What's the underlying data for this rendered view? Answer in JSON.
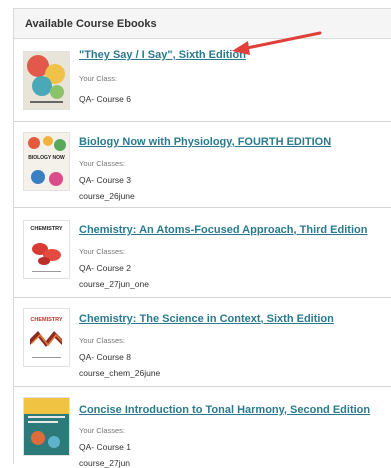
{
  "panel": {
    "title": "Available Course Ebooks"
  },
  "colors": {
    "link": "#2b7a8e",
    "arrow": "#e0403a"
  },
  "ebooks": [
    {
      "title": "\"They Say / I Say\", Sixth Edition",
      "classes_label": "Your Class:",
      "classes": [
        "QA- Course 6"
      ],
      "cover_icon": "they-say-cover"
    },
    {
      "title": "Biology Now with Physiology, FOURTH EDITION",
      "classes_label": "Your Classes:",
      "classes": [
        "QA- Course 3",
        "course_26june"
      ],
      "cover_icon": "biology-now-cover"
    },
    {
      "title": "Chemistry: An Atoms-Focused Approach, Third Edition",
      "classes_label": "Your Classes:",
      "classes": [
        "QA- Course 2",
        "course_27jun_one"
      ],
      "cover_icon": "chemistry-atoms-cover"
    },
    {
      "title": "Chemistry: The Science in Context, Sixth Edition",
      "classes_label": "Your Classes:",
      "classes": [
        "QA- Course 8",
        "course_chem_26june"
      ],
      "cover_icon": "chemistry-science-context-cover"
    },
    {
      "title": "Concise Introduction to Tonal Harmony, Second Edition",
      "classes_label": "Your Classes:",
      "classes": [
        "QA- Course 1",
        "course_27jun"
      ],
      "cover_icon": "tonal-harmony-cover"
    }
  ],
  "cover_text": {
    "chemistry_1": "CHEMISTRY",
    "chemistry_2": "CHEMISTRY",
    "biology": "BIOLOGY NOW"
  }
}
